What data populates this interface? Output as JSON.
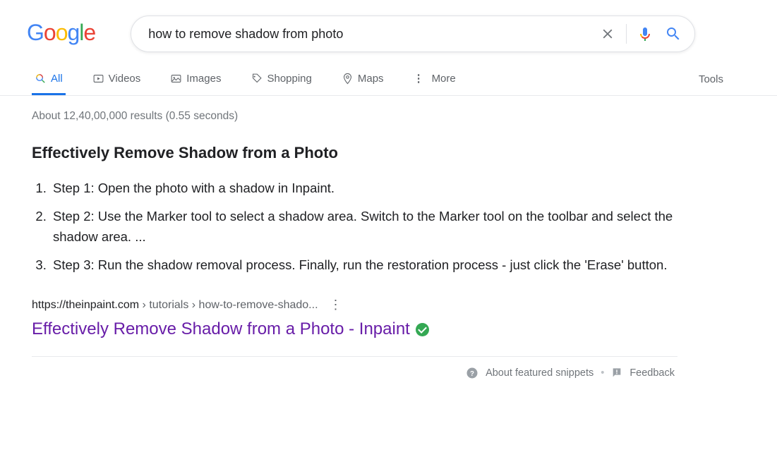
{
  "logo": "Google",
  "search": {
    "query": "how to remove shadow from photo"
  },
  "tabs": {
    "all": "All",
    "videos": "Videos",
    "images": "Images",
    "shopping": "Shopping",
    "maps": "Maps",
    "more": "More",
    "tools": "Tools"
  },
  "stats": "About 12,40,00,000 results (0.55 seconds)",
  "featured": {
    "heading": "Effectively Remove Shadow from a Photo",
    "steps": [
      "Step 1: Open the photo with a shadow in Inpaint.",
      "Step 2: Use the Marker tool to select a shadow area. Switch to the Marker tool on the toolbar and select the shadow area. ...",
      "Step 3: Run the shadow removal process. Finally, run the restoration process - just click the 'Erase' button."
    ],
    "cite_domain": "https://theinpaint.com",
    "cite_path": " › tutorials › how-to-remove-shado...",
    "result_title": "Effectively Remove Shadow from a Photo - Inpaint"
  },
  "footer": {
    "about": "About featured snippets",
    "feedback": "Feedback"
  }
}
